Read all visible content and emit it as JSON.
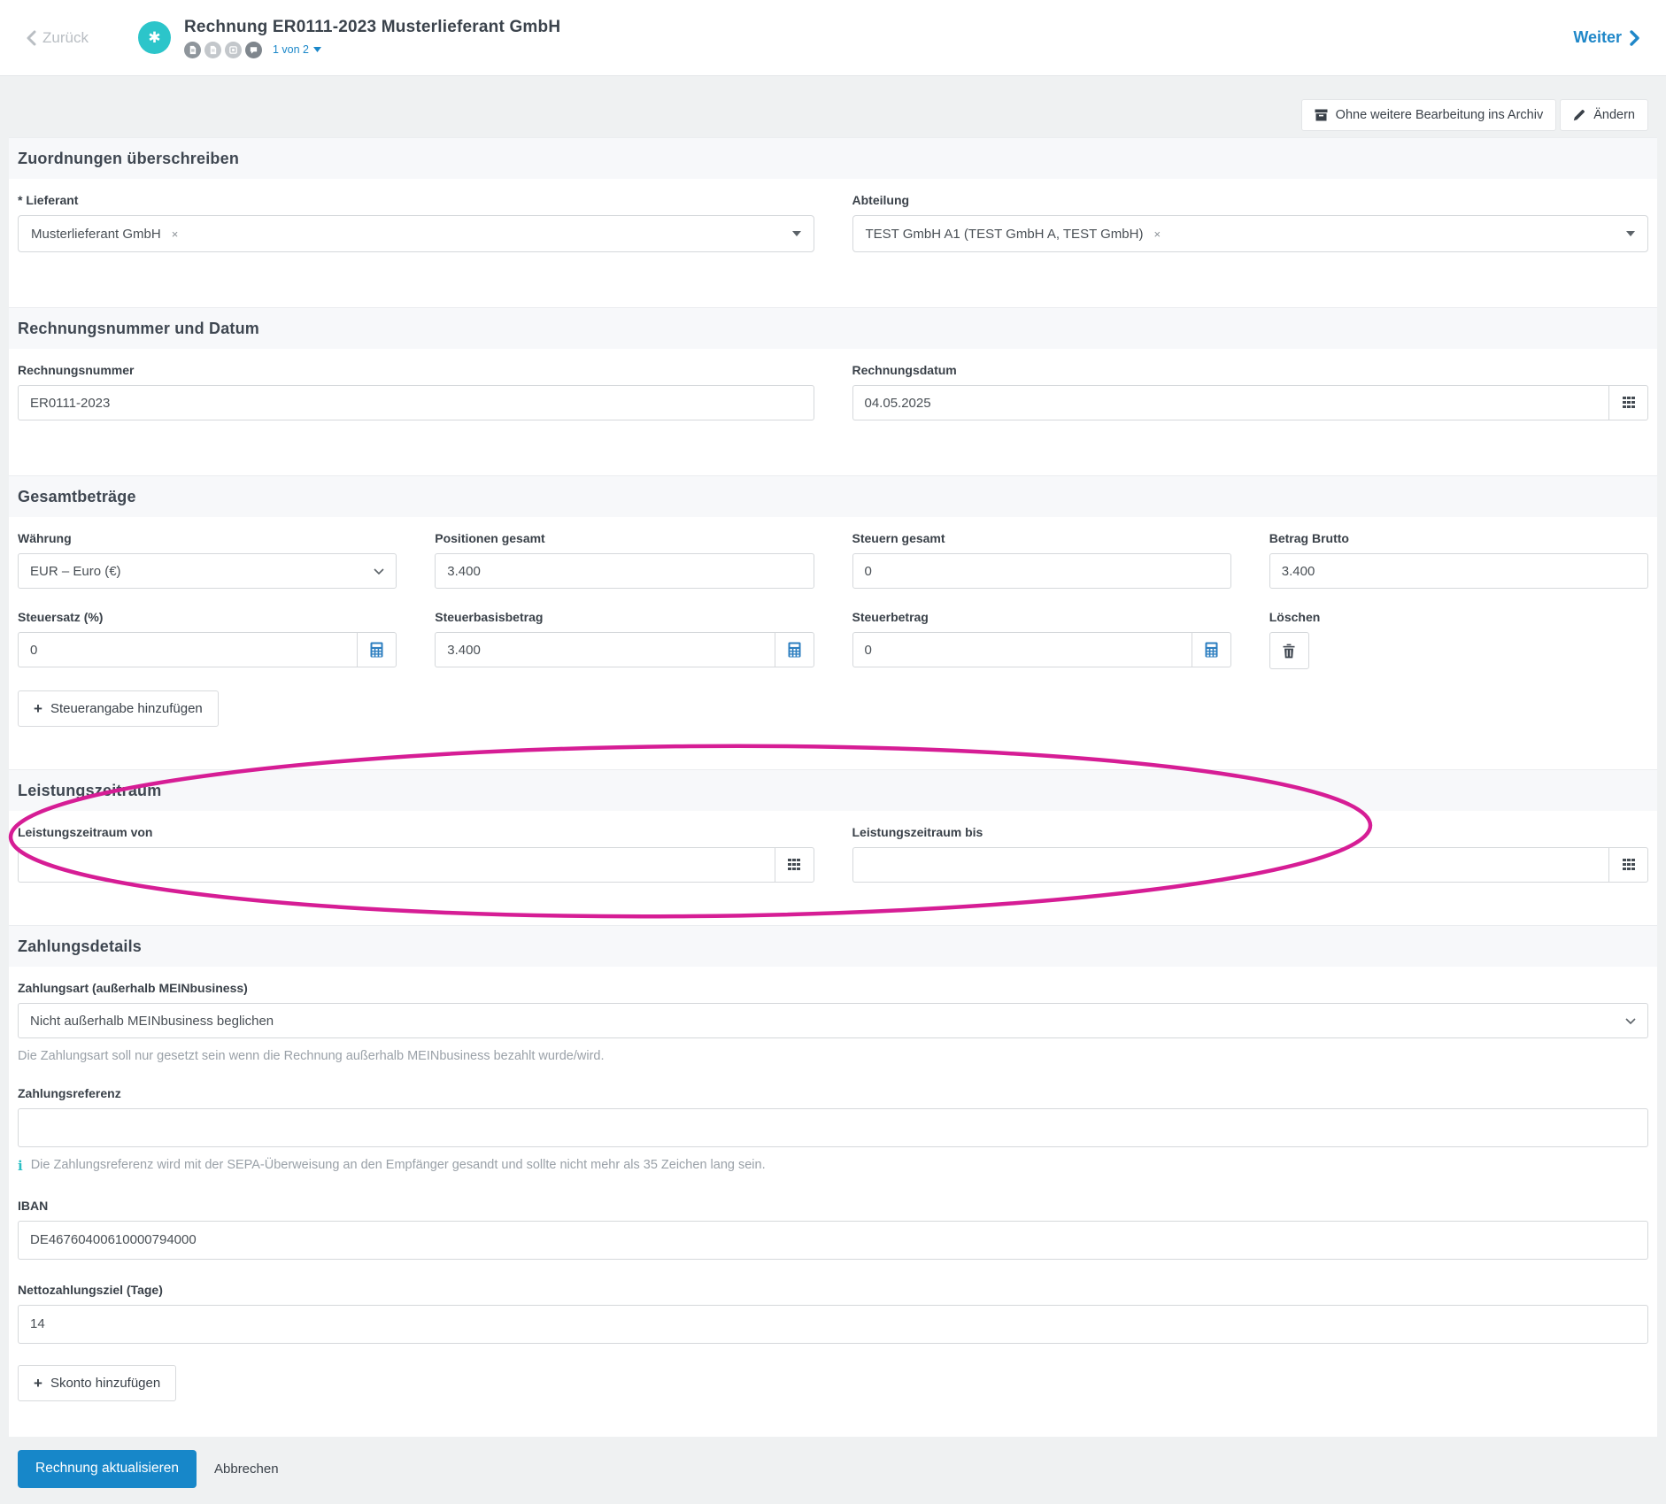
{
  "header": {
    "back_label": "Zurück",
    "title": "Rechnung ER0111-2023 Musterlieferant GmbH",
    "pager_label": "1 von 2",
    "next_label": "Weiter",
    "icons": [
      "document-icon",
      "note-icon",
      "bill-icon",
      "comment-icon"
    ]
  },
  "actions": {
    "archive_label": "Ohne weitere Bearbeitung ins Archiv",
    "edit_label": "Ändern"
  },
  "sections": {
    "assignments": {
      "title": "Zuordnungen überschreiben",
      "supplier_label": "* Lieferant",
      "supplier_value": "Musterlieferant GmbH",
      "department_label": "Abteilung",
      "department_value": "TEST GmbH A1 (TEST GmbH A, TEST GmbH)"
    },
    "invoice": {
      "title": "Rechnungsnummer und Datum",
      "number_label": "Rechnungsnummer",
      "number_value": "ER0111-2023",
      "date_label": "Rechnungsdatum",
      "date_value": "04.05.2025"
    },
    "totals": {
      "title": "Gesamtbeträge",
      "currency_label": "Währung",
      "currency_value": "EUR – Euro (€)",
      "positions_label": "Positionen gesamt",
      "positions_value": "3.400",
      "taxes_total_label": "Steuern gesamt",
      "taxes_total_value": "0",
      "gross_label": "Betrag Brutto",
      "gross_value": "3.400",
      "tax_rate_label": "Steuersatz (%)",
      "tax_rate_value": "0",
      "tax_base_label": "Steuerbasisbetrag",
      "tax_base_value": "3.400",
      "tax_amount_label": "Steuerbetrag",
      "tax_amount_value": "0",
      "delete_label": "Löschen",
      "add_tax_label": "Steuerangabe hinzufügen"
    },
    "period": {
      "title": "Leistungszeitraum",
      "from_label": "Leistungszeitraum von",
      "from_value": "",
      "to_label": "Leistungszeitraum bis",
      "to_value": ""
    },
    "payment": {
      "title": "Zahlungsdetails",
      "method_label": "Zahlungsart (außerhalb MEINbusiness)",
      "method_value": "Nicht außerhalb MEINbusiness beglichen",
      "method_help": "Die Zahlungsart soll nur gesetzt sein wenn die Rechnung außerhalb MEINbusiness bezahlt wurde/wird.",
      "reference_label": "Zahlungsreferenz",
      "reference_value": "",
      "reference_info": "Die Zahlungsreferenz wird mit der SEPA-Überweisung an den Empfänger gesandt und sollte nicht mehr als 35 Zeichen lang sein.",
      "iban_label": "IBAN",
      "iban_value": "DE46760400610000794000",
      "net_days_label": "Nettozahlungsziel (Tage)",
      "net_days_value": "14",
      "add_discount_label": "Skonto hinzufügen"
    }
  },
  "footer": {
    "submit_label": "Rechnung aktualisieren",
    "cancel_label": "Abbrechen"
  },
  "symbols": {
    "plus": "+",
    "close": "×",
    "asterisk": "✱",
    "info": "i"
  },
  "colors": {
    "accent_blue": "#1a87c9",
    "badge_teal": "#2cc5ca",
    "annotation_magenta": "#d61d95"
  },
  "annotation": {
    "shape": "hand-drawn ellipse",
    "target": "Leistungszeitraum section"
  }
}
